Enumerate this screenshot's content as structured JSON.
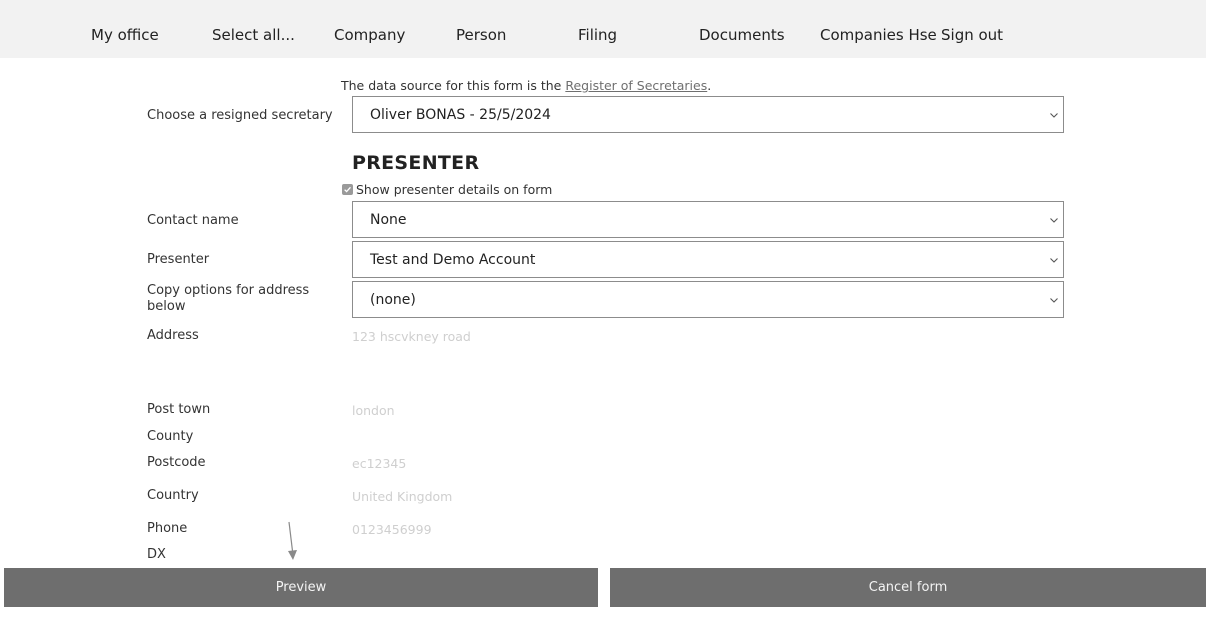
{
  "nav": {
    "items": [
      "My office",
      "Select all...",
      "Company",
      "Person",
      "Filing",
      "Documents",
      "Companies Hse",
      "Sign out"
    ]
  },
  "source_note": {
    "prefix": "The data source for this form is the ",
    "link": "Register of Secretaries",
    "suffix": "."
  },
  "resigned_secretary": {
    "label": "Choose a resigned secretary",
    "value": "Oliver BONAS - 25/5/2024"
  },
  "presenter_section": {
    "heading": "PRESENTER",
    "show_details_label": "Show presenter details on form",
    "show_details_checked": true
  },
  "fields": {
    "contact_name": {
      "label": "Contact name",
      "value": "None"
    },
    "presenter": {
      "label": "Presenter",
      "value": "Test and Demo Account"
    },
    "copy_options": {
      "label": "Copy options for address below",
      "value": "(none)"
    },
    "address": {
      "label": "Address",
      "value": "123 hscvkney road"
    },
    "post_town": {
      "label": "Post town",
      "value": "london"
    },
    "county": {
      "label": "County",
      "value": ""
    },
    "postcode": {
      "label": "Postcode",
      "value": "ec12345"
    },
    "country": {
      "label": "Country",
      "value": "United Kingdom"
    },
    "phone": {
      "label": "Phone",
      "value": "0123456999"
    },
    "dx": {
      "label": "DX",
      "value": ""
    }
  },
  "buttons": {
    "preview": "Preview",
    "cancel": "Cancel form"
  },
  "icons": {
    "chevron": "chevron-down-icon",
    "checkbox": "checkmark-icon",
    "arrow": "arrow-down-icon"
  },
  "colors": {
    "nav_bg": "#f2f2f2",
    "button_bg": "#6e6e6e",
    "ghost_text": "#cfcfcf"
  }
}
